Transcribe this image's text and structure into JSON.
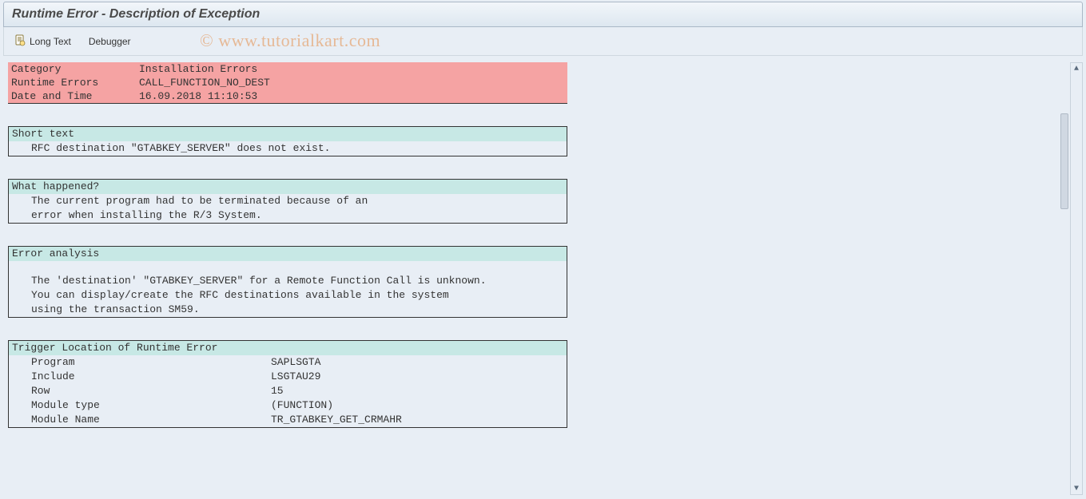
{
  "title": "Runtime Error - Description of Exception",
  "toolbar": {
    "long_text": "Long Text",
    "debugger": "Debugger"
  },
  "watermark": "© www.tutorialkart.com",
  "header": {
    "category_label": "Category",
    "category_value": "Installation Errors",
    "runtime_label": "Runtime Errors",
    "runtime_value": "CALL_FUNCTION_NO_DEST",
    "datetime_label": "Date and Time",
    "datetime_value": "16.09.2018 11:10:53"
  },
  "short_text": {
    "head": "Short text",
    "line1": "RFC destination \"GTABKEY_SERVER\" does not exist."
  },
  "what_happened": {
    "head": "What happened?",
    "line1": "The current program had to be terminated because of an",
    "line2": "error when installing the R/3 System."
  },
  "error_analysis": {
    "head": "Error analysis",
    "line1": "The 'destination' \"GTABKEY_SERVER\" for a Remote Function Call is unknown.",
    "line2": "You can display/create the RFC destinations available in the system",
    "line3": "using the transaction SM59."
  },
  "trigger": {
    "head": "Trigger Location of Runtime Error",
    "program_label": "Program",
    "program_value": "SAPLSGTA",
    "include_label": "Include",
    "include_value": "LSGTAU29",
    "row_label": "Row",
    "row_value": "15",
    "mtype_label": "Module type",
    "mtype_value": "(FUNCTION)",
    "mname_label": "Module Name",
    "mname_value": "TR_GTABKEY_GET_CRMAHR"
  }
}
